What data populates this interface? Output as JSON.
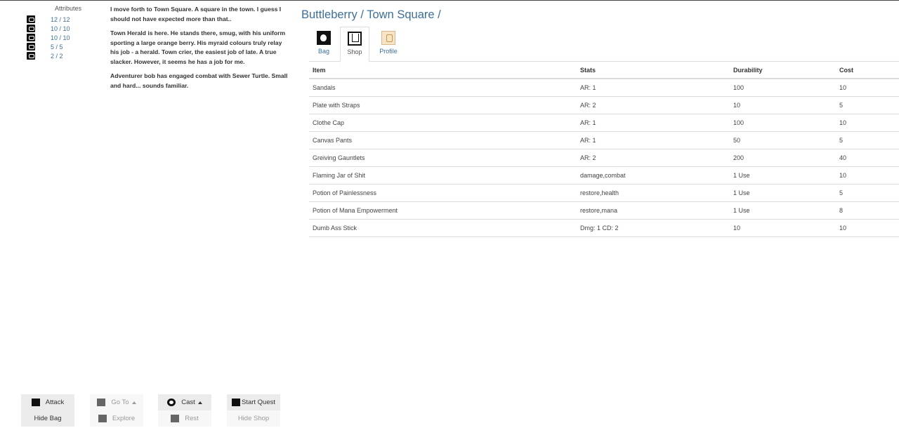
{
  "attributes": {
    "title": "Attributes",
    "rows": [
      {
        "icon": "health-icon",
        "value": "12 / 12"
      },
      {
        "icon": "mana-icon",
        "value": "10 / 10"
      },
      {
        "icon": "stamina-icon",
        "value": "10 / 10"
      },
      {
        "icon": "strength-icon",
        "value": "5 / 5"
      },
      {
        "icon": "defense-icon",
        "value": "2 / 2"
      }
    ]
  },
  "log": [
    "I move forth to Town Square. A square in the town. I guess I should not have expected more than that..",
    "Town Herald is here. He stands there, smug, with his uniform sporting a large orange berry. His myraid colours truly relay his job - a herald. Town crier, the easiest job of late. A true slacker. However, it seems he has a job for me.",
    "Adventurer bob has engaged combat with Sewer Turtle. Small and hard... sounds familiar."
  ],
  "breadcrumb": "Buttleberry / Town Square /",
  "tabs": [
    {
      "label": "Bag",
      "icon": "bag-icon",
      "active": false
    },
    {
      "label": "Shop",
      "icon": "shop-icon",
      "active": true
    },
    {
      "label": "Profile",
      "icon": "profile-icon",
      "active": false
    }
  ],
  "shop": {
    "headers": [
      "Item",
      "Stats",
      "Durability",
      "Cost"
    ],
    "rows": [
      [
        "Sandals",
        "AR: 1",
        "100",
        "10"
      ],
      [
        "Plate with Straps",
        "AR: 2",
        "10",
        "5"
      ],
      [
        "Clothe Cap",
        "AR: 1",
        "100",
        "10"
      ],
      [
        "Canvas Pants",
        "AR: 1",
        "50",
        "5"
      ],
      [
        "Greiving Gauntlets",
        "AR: 2",
        "200",
        "40"
      ],
      [
        "Flaming Jar of Shit",
        "damage,combat",
        "1 Use",
        "10"
      ],
      [
        "Potion of Painlessness",
        "restore,health",
        "1 Use",
        "5"
      ],
      [
        "Potion of Mana Empowerment",
        "restore,mana",
        "1 Use",
        "8"
      ],
      [
        "Dumb Ass Stick",
        "Dmg: 1 CD: 2",
        "10",
        "10"
      ]
    ]
  },
  "actions": {
    "attack": "Attack",
    "hide_bag": "Hide Bag",
    "go_to": "Go To",
    "explore": "Explore",
    "cast": "Cast",
    "rest": "Rest",
    "start_quest": "Start Quest",
    "hide_shop": "Hide Shop"
  }
}
